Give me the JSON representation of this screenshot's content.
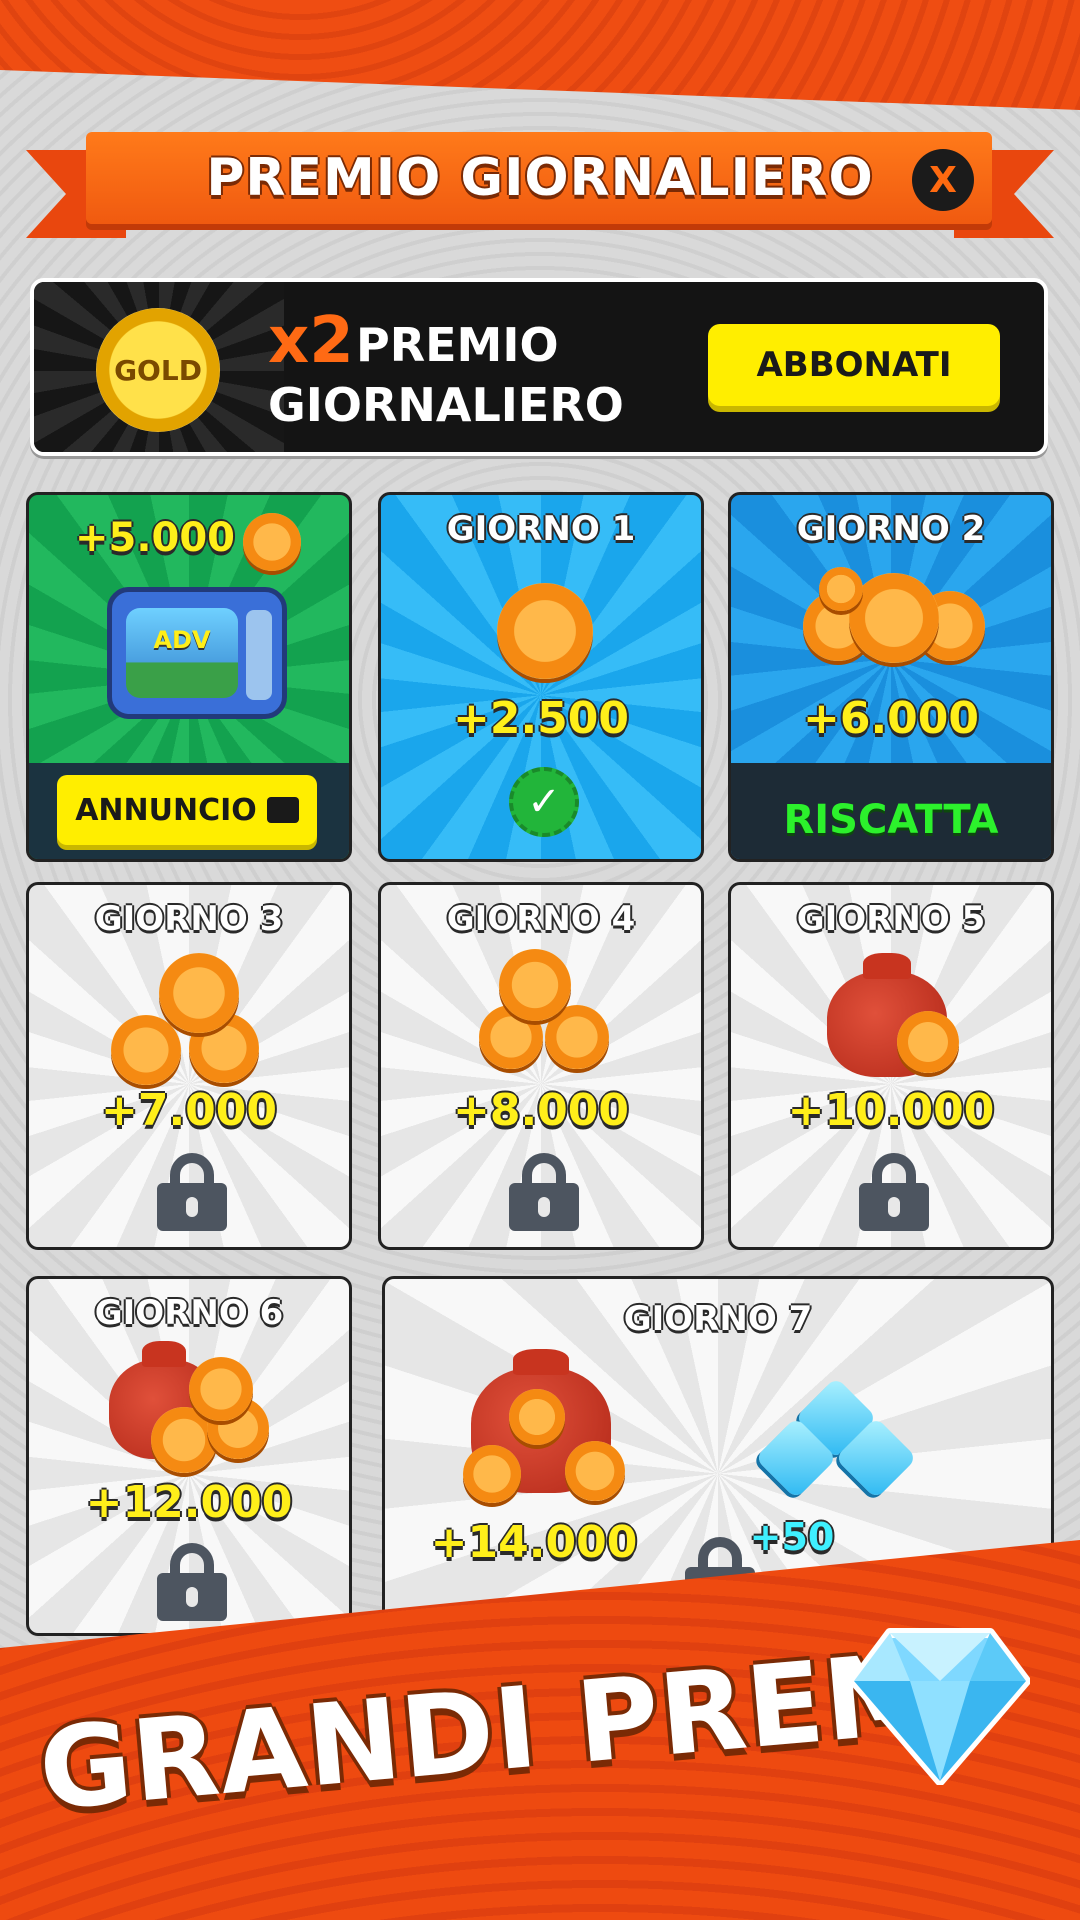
{
  "header": {
    "title": "PREMIO GIORNALIERO",
    "close_label": "X"
  },
  "banner": {
    "badge_text": "GOLD",
    "multiplier": "x2",
    "line1": "PREMIO",
    "line2": "GIORNALIERO",
    "subscribe_label": "ABBONATI"
  },
  "ad_card": {
    "amount": "+5.000",
    "screen_text": "ADV",
    "button_label": "ANNUNCIO"
  },
  "days": [
    {
      "label": "GIORNO 1",
      "amount": "+2.500",
      "state": "claimed"
    },
    {
      "label": "GIORNO 2",
      "amount": "+6.000",
      "state": "available",
      "action_label": "RISCATTA"
    },
    {
      "label": "GIORNO 3",
      "amount": "+7.000",
      "state": "locked"
    },
    {
      "label": "GIORNO 4",
      "amount": "+8.000",
      "state": "locked"
    },
    {
      "label": "GIORNO 5",
      "amount": "+10.000",
      "state": "locked"
    },
    {
      "label": "GIORNO 6",
      "amount": "+12.000",
      "state": "locked"
    },
    {
      "label": "GIORNO 7",
      "amount": "+14.000",
      "gem_amount": "+50",
      "state": "locked"
    }
  ],
  "promo": {
    "slogan": "GRANDI PREMI"
  },
  "icons": [
    "close-icon",
    "gold-badge-icon",
    "tv-icon",
    "coin-icon",
    "check-icon",
    "lock-icon",
    "coin-sack-icon",
    "coin-purse-icon",
    "gem-icon",
    "diamond-icon",
    "video-icon"
  ],
  "colors": {
    "accent": "#ff6a14",
    "button_yellow": "#ffee00",
    "redeem_green": "#2cf12c",
    "amount_yellow": "#ffef1a"
  }
}
